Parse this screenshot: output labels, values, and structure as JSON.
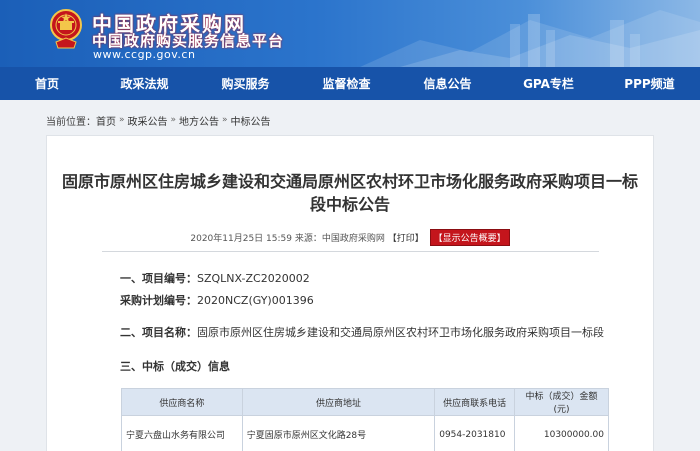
{
  "header": {
    "title": "中国政府采购网",
    "subtitle": "中国政府购买服务信息平台",
    "url": "www.ccgp.gov.cn",
    "emblem_icon": "national-emblem-icon",
    "colors": {
      "banner": "#2b74cc",
      "nav": "#1753a9",
      "accent_red": "#c4151c"
    }
  },
  "nav": {
    "items": [
      {
        "label": "首页"
      },
      {
        "label": "政采法规"
      },
      {
        "label": "购买服务"
      },
      {
        "label": "监督检查"
      },
      {
        "label": "信息公告"
      },
      {
        "label": "GPA专栏"
      },
      {
        "label": "PPP频道"
      }
    ]
  },
  "breadcrumb": {
    "prefix": "当前位置：",
    "items": [
      {
        "label": "首页"
      },
      {
        "label": "政采公告"
      },
      {
        "label": "地方公告"
      },
      {
        "label": "中标公告"
      }
    ],
    "separator": "»"
  },
  "article": {
    "title": "固原市原州区住房城乡建设和交通局原州区农村环卫市场化服务政府采购项目一标段中标公告",
    "meta_text": "2020年11月25日 15:59 来源：中国政府采购网",
    "print_label": "【打印】",
    "summary_button": "【显示公告概要】",
    "sections": {
      "project_number_label": "一、项目编号：",
      "project_number": "SZQLNX-ZC2020002",
      "plan_number_label": "采购计划编号：",
      "plan_number": "2020NCZ(GY)001396",
      "project_name_label": "二、项目名称：",
      "project_name": "固原市原州区住房城乡建设和交通局原州区农村环卫市场化服务政府采购项目一标段",
      "award_heading": "三、中标（成交）信息"
    },
    "table": {
      "headers": [
        "供应商名称",
        "供应商地址",
        "供应商联系电话",
        "中标（成交）金额(元)"
      ],
      "rows": [
        [
          "宁夏六盘山水务有限公司",
          "宁夏固原市原州区文化路28号",
          "0954-2031810",
          "10300000.00"
        ]
      ]
    }
  }
}
